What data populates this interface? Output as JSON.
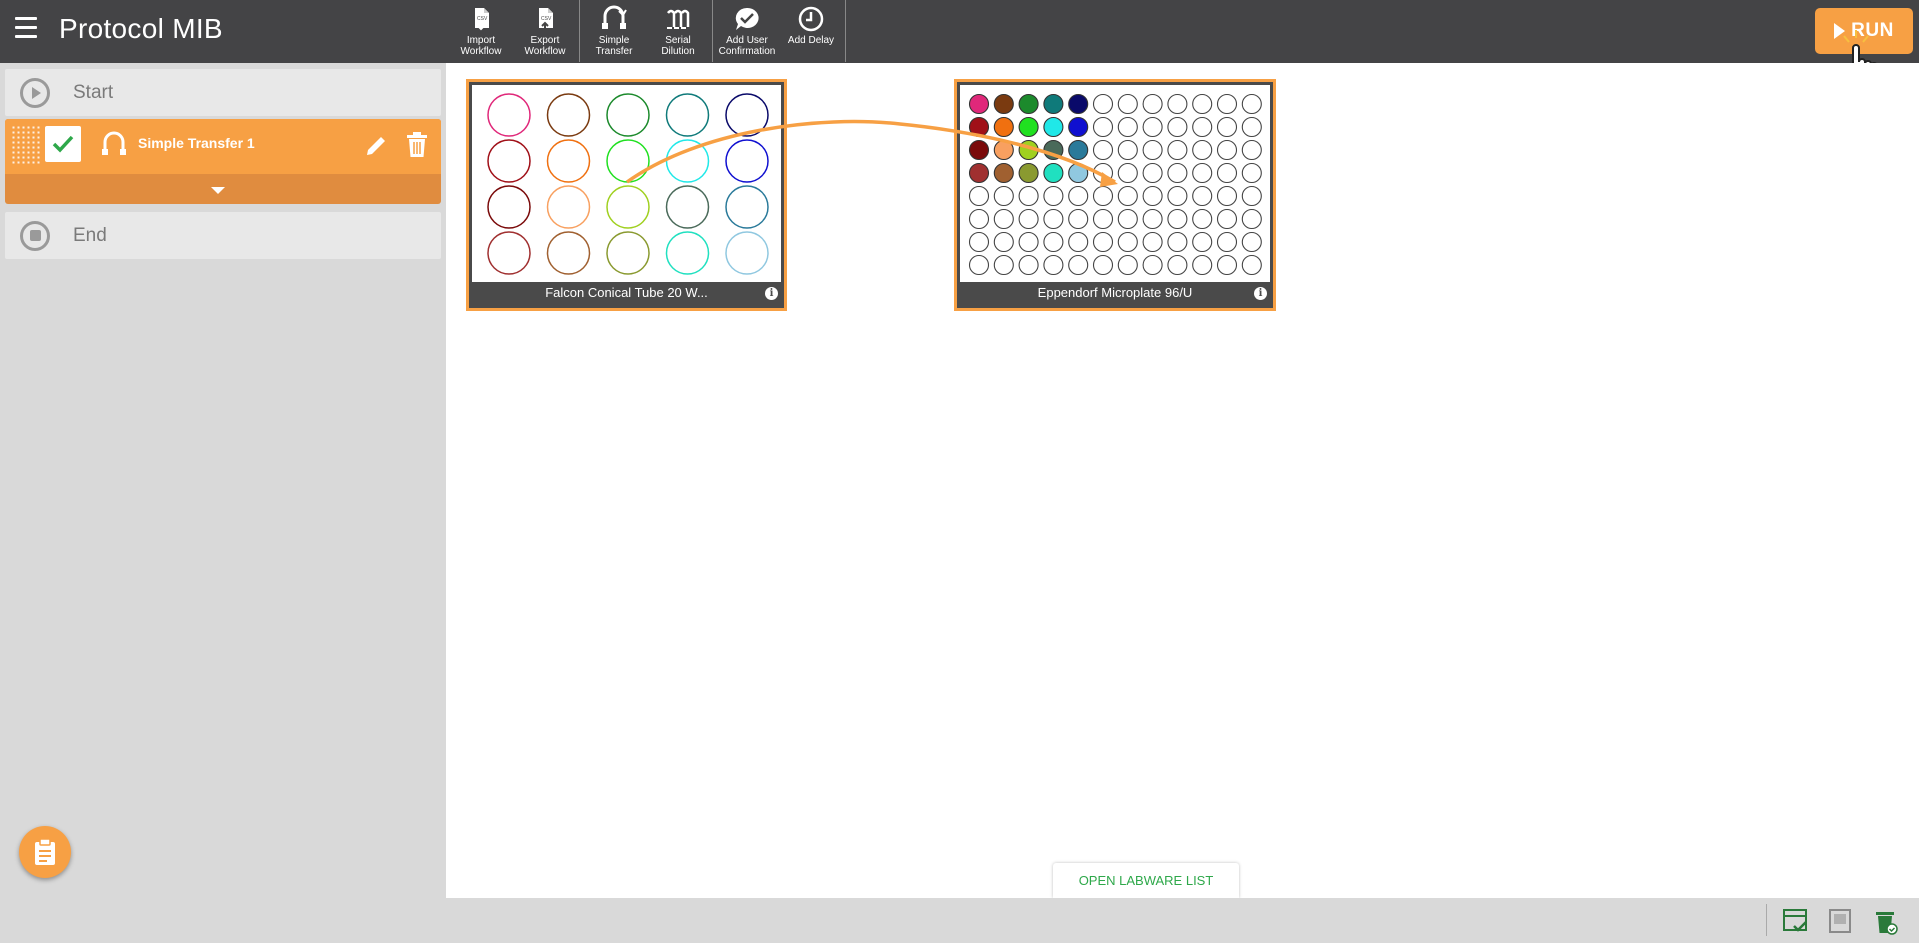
{
  "header": {
    "title": "Protocol MIB",
    "run_label": "RUN"
  },
  "toolbar": {
    "groups": [
      [
        {
          "label": "Import\nWorkflow",
          "icon": "import-file-icon"
        },
        {
          "label": "Export\nWorkflow",
          "icon": "export-file-icon"
        }
      ],
      [
        {
          "label": "Simple\nTransfer",
          "icon": "pipette-transfer-icon"
        },
        {
          "label": "Serial\nDilution",
          "icon": "serial-dilution-icon"
        }
      ],
      [
        {
          "label": "Add User\nConfirmation",
          "icon": "confirmation-icon"
        },
        {
          "label": "Add Delay",
          "icon": "clock-icon"
        }
      ]
    ]
  },
  "sidebar": {
    "start_label": "Start",
    "step_name": "Simple Transfer 1",
    "end_label": "End"
  },
  "labware": {
    "source": {
      "label": "Falcon Conical Tube 20 W...",
      "rows": 4,
      "cols": 5,
      "tube_colors": [
        [
          "#e0287a",
          "#7a3a10",
          "#1c8a2c",
          "#0f7a7a",
          "#0a0a6a"
        ],
        [
          "#a01018",
          "#f07010",
          "#20e020",
          "#20e8e8",
          "#1010d0"
        ],
        [
          "#7a0a0a",
          "#f8a060",
          "#a0d020",
          "#4a6a5a",
          "#2a7a9a"
        ],
        [
          "#a03030",
          "#a06030",
          "#8a9a30",
          "#20e0c0",
          "#90c8e0"
        ]
      ]
    },
    "destination": {
      "label": "Eppendorf Microplate 96/U",
      "rows": 8,
      "cols": 12,
      "filled_colors": [
        [
          "#e0287a",
          "#7a3a10",
          "#1c8a2c",
          "#0f7a7a",
          "#0a0a6a"
        ],
        [
          "#a01018",
          "#f07010",
          "#20e020",
          "#20e8e8",
          "#1010d0"
        ],
        [
          "#7a0a0a",
          "#f8a060",
          "#a0d020",
          "#4a6a5a",
          "#2a7a9a"
        ],
        [
          "#a03030",
          "#a06030",
          "#8a9a30",
          "#20e0c0",
          "#90c8e0"
        ]
      ]
    }
  },
  "transfer_arrow_color": "#f7a044",
  "open_labware_label": "OPEN LABWARE LIST",
  "colors": {
    "accent": "#f7a044",
    "header_bg": "#444446",
    "sidebar_bg": "#d9d9d9",
    "link_green": "#2ea84a"
  }
}
